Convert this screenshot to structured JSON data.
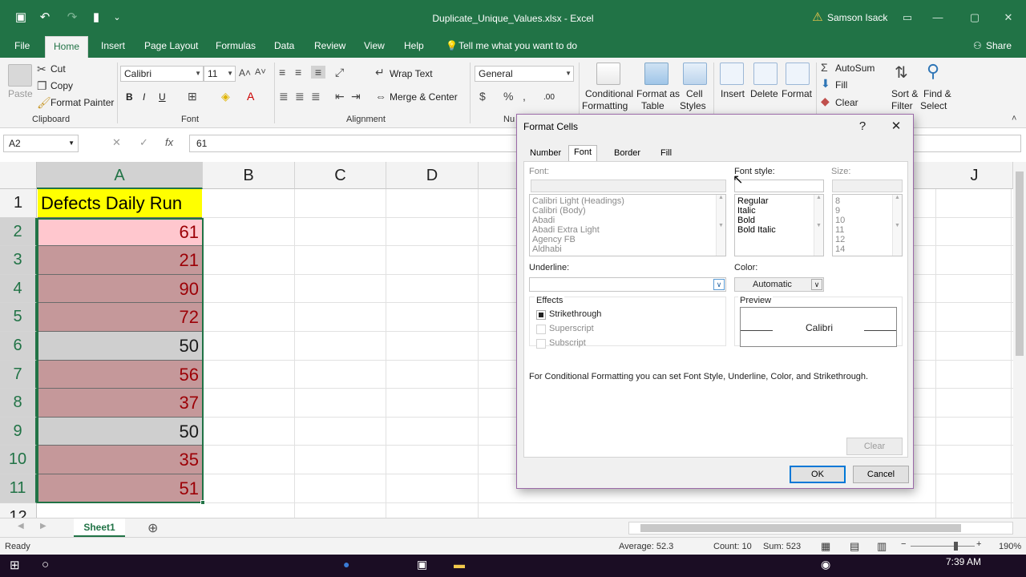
{
  "window": {
    "title": "Duplicate_Unique_Values.xlsx  -  Excel",
    "user": "Samson Isack"
  },
  "menu": {
    "tabs": [
      "File",
      "Home",
      "Insert",
      "Page Layout",
      "Formulas",
      "Data",
      "Review",
      "View",
      "Help"
    ],
    "tell_me": "Tell me what you want to do",
    "share": "Share"
  },
  "ribbon": {
    "clipboard": {
      "paste": "Paste",
      "cut": "Cut",
      "copy": "Copy",
      "format_painter": "Format Painter",
      "label": "Clipboard"
    },
    "font": {
      "name": "Calibri",
      "size": "11",
      "label": "Font",
      "bold": "B",
      "italic": "I",
      "underline": "U"
    },
    "alignment": {
      "wrap_text": "Wrap Text",
      "merge_center": "Merge & Center",
      "label": "Alignment"
    },
    "number": {
      "format": "General",
      "label": "Nu"
    },
    "styles": {
      "conditional_formatting": [
        "Conditional",
        "Formatting"
      ],
      "format_as_table": [
        "Format as",
        "Table"
      ],
      "cell_styles": [
        "Cell",
        "Styles"
      ]
    },
    "cells": {
      "insert": "Insert",
      "delete": "Delete",
      "format": "Format"
    },
    "editing": {
      "autosum": "AutoSum",
      "fill": "Fill",
      "clear": "Clear",
      "sort_filter": [
        "Sort &",
        "Filter"
      ],
      "find_select": [
        "Find &",
        "Select"
      ]
    }
  },
  "formula_bar": {
    "name_box": "A2",
    "value": "61"
  },
  "grid": {
    "columns": [
      "A",
      "B",
      "C",
      "D",
      "J"
    ],
    "rows": [
      "1",
      "2",
      "3",
      "4",
      "5",
      "6",
      "7",
      "8",
      "9",
      "10",
      "11",
      "12"
    ],
    "header_cell": "Defects Daily Run",
    "values": [
      "61",
      "21",
      "90",
      "72",
      "50",
      "56",
      "37",
      "50",
      "35",
      "51"
    ],
    "colors": {
      "header_fill": "#ffff00",
      "selected_fill": "#ffc7ce",
      "fill_highlight": "#c5989a",
      "fill_plain": "#cfcfcf",
      "text_red": "#9c0006",
      "text_plain": "#1a1a1a"
    }
  },
  "sheet_tabs": {
    "active": "Sheet1"
  },
  "status": {
    "ready": "Ready",
    "average": "Average: 52.3",
    "count": "Count: 10",
    "sum": "Sum: 523",
    "zoom": "190%"
  },
  "taskbar": {
    "time": "7:39 AM"
  },
  "dialog": {
    "title": "Format Cells",
    "tabs": [
      "Number",
      "Font",
      "Border",
      "Fill"
    ],
    "font_label": "Font:",
    "font_style_label": "Font style:",
    "size_label": "Size:",
    "fonts": [
      "Calibri Light (Headings)",
      "Calibri (Body)",
      "Abadi",
      "Abadi Extra Light",
      "Agency FB",
      "Aldhabi"
    ],
    "styles": [
      "Regular",
      "Italic",
      "Bold",
      "Bold Italic"
    ],
    "sizes": [
      "8",
      "9",
      "10",
      "11",
      "12",
      "14"
    ],
    "underline_label": "Underline:",
    "color_label": "Color:",
    "color_value": "Automatic",
    "effects_label": "Effects",
    "strikethrough": "Strikethrough",
    "superscript": "Superscript",
    "subscript": "Subscript",
    "preview_label": "Preview",
    "preview_text": "Calibri",
    "note": "For Conditional Formatting you can set Font Style, Underline, Color, and Strikethrough.",
    "clear": "Clear",
    "ok": "OK",
    "cancel": "Cancel"
  }
}
